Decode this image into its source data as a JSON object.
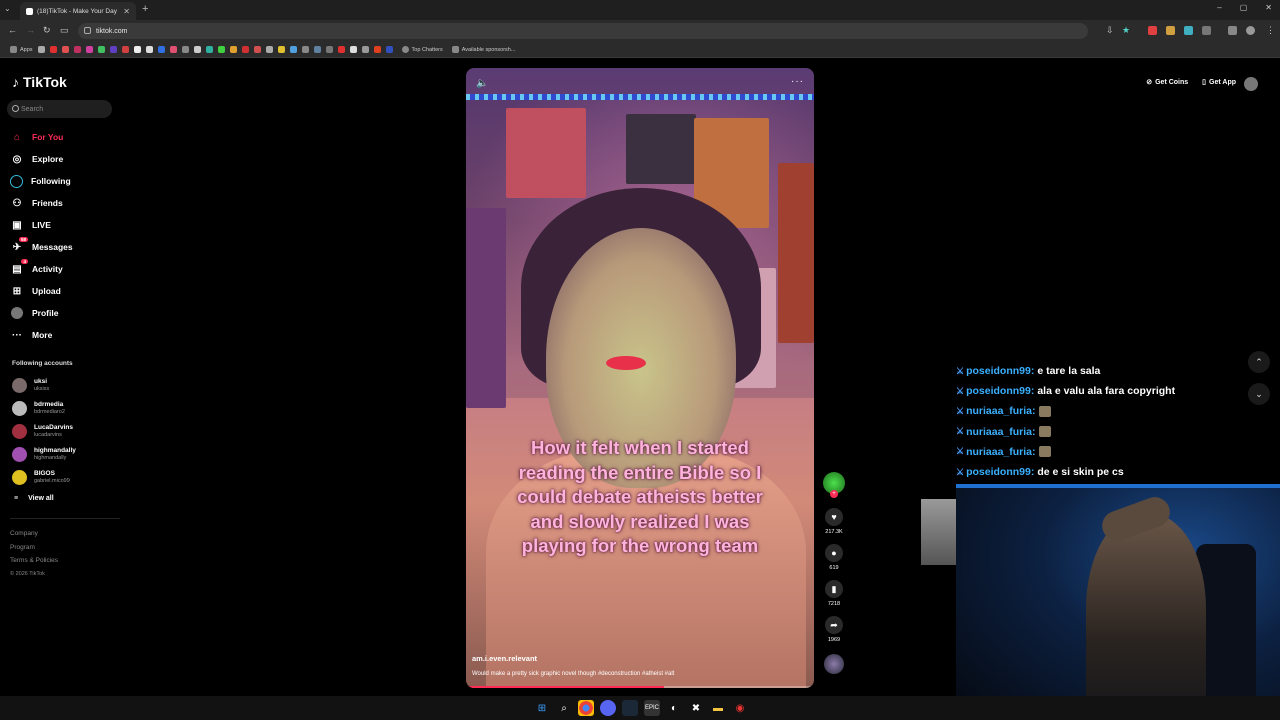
{
  "browser": {
    "tab_title": "(18)TikTok - Make Your Day",
    "url": "tiktok.com",
    "bookmarks": {
      "apps": "Apps",
      "top_chatters": "Top Chatters",
      "sponsorship": "Available sponsorsh..."
    }
  },
  "tiktok": {
    "logo": "TikTok",
    "search_placeholder": "Search",
    "menu": [
      {
        "label": "For You",
        "icon": "home-icon",
        "active": true
      },
      {
        "label": "Explore",
        "icon": "compass-icon"
      },
      {
        "label": "Following",
        "icon": "following-icon"
      },
      {
        "label": "Friends",
        "icon": "friends-icon"
      },
      {
        "label": "LIVE",
        "icon": "live-icon"
      },
      {
        "label": "Messages",
        "icon": "messages-icon",
        "badge": "58"
      },
      {
        "label": "Activity",
        "icon": "activity-icon",
        "badge": "4"
      },
      {
        "label": "Upload",
        "icon": "upload-icon"
      },
      {
        "label": "Profile",
        "icon": "profile-icon"
      },
      {
        "label": "More",
        "icon": "more-icon"
      }
    ],
    "following_title": "Following accounts",
    "accounts": [
      {
        "name": "uksi",
        "handle": "uksiss"
      },
      {
        "name": "bdrmedia",
        "handle": "bdrmediaro2"
      },
      {
        "name": "LucaDarvins",
        "handle": "lucadarvins"
      },
      {
        "name": "highmandally",
        "handle": "highmandally"
      },
      {
        "name": "BIGOS",
        "handle": "gabriel.mico99"
      }
    ],
    "view_all": "View all",
    "footer": {
      "company": "Company",
      "program": "Program",
      "terms": "Terms & Policies",
      "copyright": "© 2026 TikTok"
    },
    "top_buttons": {
      "get_coins": "Get Coins",
      "get_app": "Get App"
    }
  },
  "video": {
    "caption": "How it felt when I started reading the entire Bible so I could debate atheists better and slowly realized I was playing for the wrong team",
    "author": "am.i.even.relevant",
    "description": "Would make a pretty sick graphic novel though #deconstruction #atheist #alt",
    "progress": 0.57,
    "likes": "217.3K",
    "comments": "619",
    "saves": "7218",
    "shares": "1969"
  },
  "chat": [
    {
      "user": "poseidonn99",
      "message": "e tare la sala"
    },
    {
      "user": "poseidonn99",
      "message": "ala e valu ala fara copyright"
    },
    {
      "user": "nuriaaa_furia",
      "message": "",
      "emote": true
    },
    {
      "user": "nuriaaa_furia",
      "message": "",
      "emote": true
    },
    {
      "user": "nuriaaa_furia",
      "message": "",
      "emote": true
    },
    {
      "user": "poseidonn99",
      "message": "de e si skin pe cs"
    }
  ]
}
